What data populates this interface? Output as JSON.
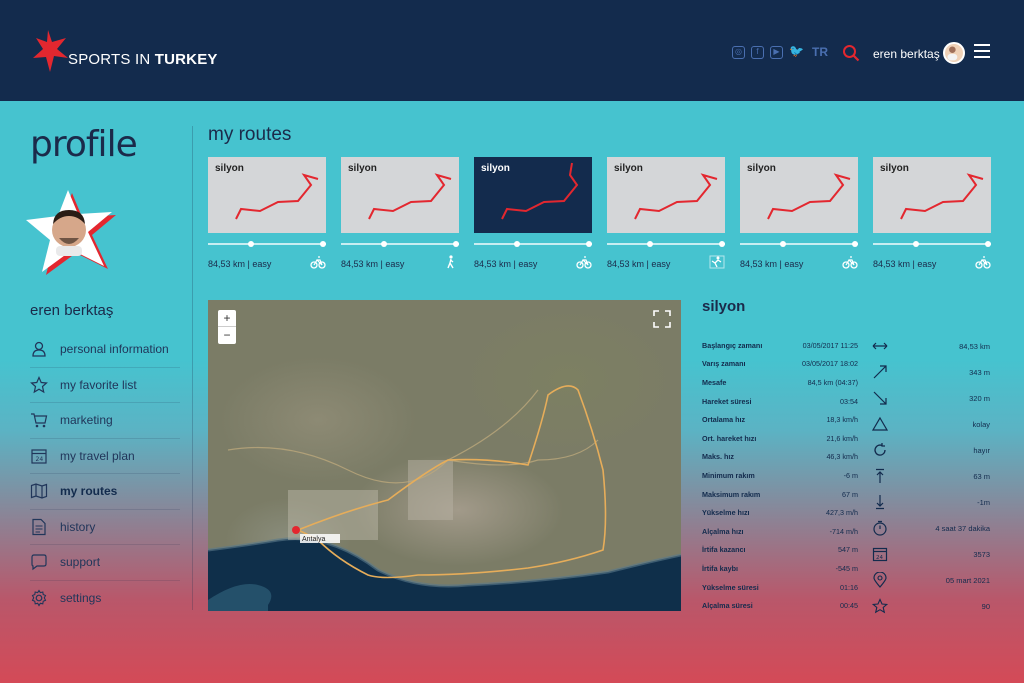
{
  "header": {
    "logo_text_light": "SPORTS IN",
    "logo_text_bold": "TURKEY",
    "social_icons": [
      "instagram-icon",
      "facebook-icon",
      "youtube-icon",
      "twitter-icon"
    ],
    "language": "TR",
    "user_name": "eren berktaş",
    "colors": {
      "background": "#132b4d",
      "accent": "#e3272f"
    }
  },
  "sidebar": {
    "title": "profile",
    "user_name": "eren berktaş",
    "items": [
      {
        "label": "personal information",
        "icon": "user-icon"
      },
      {
        "label": "my favorite list",
        "icon": "star-icon"
      },
      {
        "label": "marketing",
        "icon": "cart-icon"
      },
      {
        "label": "my travel plan",
        "icon": "calendar-icon"
      },
      {
        "label": "my routes",
        "icon": "map-icon",
        "active": true
      },
      {
        "label": "history",
        "icon": "document-icon"
      },
      {
        "label": "support",
        "icon": "chat-icon"
      },
      {
        "label": "settings",
        "icon": "gear-icon"
      }
    ]
  },
  "routes": {
    "title": "my routes",
    "cards": [
      {
        "name": "silyon",
        "meta": "84,53 km | easy",
        "mode": "bike-icon"
      },
      {
        "name": "silyon",
        "meta": "84,53 km | easy",
        "mode": "hiking-icon"
      },
      {
        "name": "silyon",
        "meta": "84,53 km | easy",
        "mode": "bike-icon",
        "active": true
      },
      {
        "name": "silyon",
        "meta": "84,53 km | easy",
        "mode": "climbing-icon"
      },
      {
        "name": "silyon",
        "meta": "84,53 km | easy",
        "mode": "bike-icon"
      },
      {
        "name": "silyon",
        "meta": "84,53 km | easy",
        "mode": "bike-icon"
      }
    ]
  },
  "map": {
    "zoom_in": "+",
    "zoom_out": "−",
    "place_label": "Antalya"
  },
  "detail": {
    "title": "silyon",
    "rows": [
      {
        "k": "Başlangıç zamanı",
        "v": "03/05/2017 11:25"
      },
      {
        "k": "Varış zamanı",
        "v": "03/05/2017 18:02"
      },
      {
        "k": "Mesafe",
        "v": "84,5 km (04:37)"
      },
      {
        "k": "Hareket süresi",
        "v": "03:54"
      },
      {
        "k": "Ortalama hız",
        "v": "18,3 km/h"
      },
      {
        "k": "Ort. hareket hızı",
        "v": "21,6 km/h"
      },
      {
        "k": "Maks. hız",
        "v": "46,3 km/h"
      },
      {
        "k": "Minimum rakım",
        "v": "-6 m"
      },
      {
        "k": "Maksimum rakım",
        "v": "67 m"
      },
      {
        "k": "Yükselme hızı",
        "v": "427,3 m/h"
      },
      {
        "k": "Alçalma hızı",
        "v": "-714 m/h"
      },
      {
        "k": "İrtifa kazancı",
        "v": "547 m"
      },
      {
        "k": "İrtifa kaybı",
        "v": "-545 m"
      },
      {
        "k": "Yükselme süresi",
        "v": "01:16"
      },
      {
        "k": "Alçalma süresi",
        "v": "00:45"
      }
    ],
    "stats": [
      {
        "icon": "distance-icon",
        "v": "84,53 km"
      },
      {
        "icon": "ascent-icon",
        "v": "343 m"
      },
      {
        "icon": "descent-icon",
        "v": "320 m"
      },
      {
        "icon": "difficulty-icon",
        "v": "kolay"
      },
      {
        "icon": "loop-icon",
        "v": "hayır"
      },
      {
        "icon": "max-elevation-icon",
        "v": "63 m"
      },
      {
        "icon": "min-elevation-icon",
        "v": "-1m"
      },
      {
        "icon": "timer-icon",
        "v": "4 saat 37 dakika"
      },
      {
        "icon": "calendar-icon",
        "v": "3573"
      },
      {
        "icon": "location-icon",
        "v": "05 mart 2021"
      },
      {
        "icon": "star-icon",
        "v": "90"
      }
    ]
  }
}
